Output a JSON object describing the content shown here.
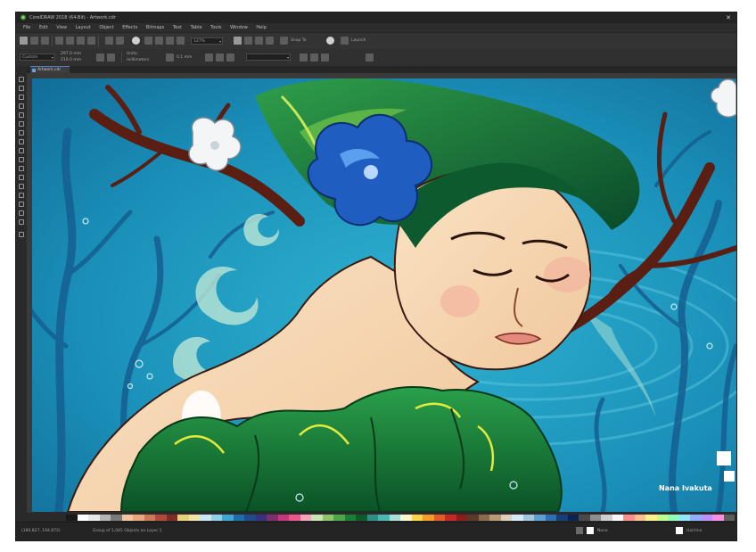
{
  "window": {
    "title": "CorelDRAW 2018 (64-Bit) - Artwork.cdr",
    "close_glyph": "✕"
  },
  "menu": [
    "File",
    "Edit",
    "View",
    "Layout",
    "Object",
    "Effects",
    "Bitmaps",
    "Text",
    "Table",
    "Tools",
    "Window",
    "Help"
  ],
  "toolbar": {
    "zoom_value": "127%",
    "snap_label": "Snap To",
    "launch_label": "Launch"
  },
  "property_bar": {
    "page_size": "Custom",
    "width": "297.0 mm",
    "height": "210.0 mm",
    "units_label": "Units:",
    "units_value": "millimeters",
    "nudge_value": "0.1 mm"
  },
  "document_tab": {
    "label": "Artwork.cdr"
  },
  "canvas": {
    "signature_text": "Nana Ivakuta"
  },
  "status": {
    "cursor": "(180.827, 194.872)",
    "selection": "Group of 1,045 Objects on Layer 1",
    "fill_label": "None",
    "outline_label": "Hairline"
  },
  "palette": {
    "colors": [
      "#1a1a1a",
      "#ffffff",
      "#e8e8e8",
      "#b5b5b5",
      "#7a7a7a",
      "#f3c4a0",
      "#e8a87c",
      "#cc7a55",
      "#b04a3a",
      "#7b2d26",
      "#e6d07a",
      "#f2e4a4",
      "#c9e7f2",
      "#8fd0e8",
      "#3fa6d1",
      "#1a6fa8",
      "#204a8a",
      "#3a2f7a",
      "#7d2e6d",
      "#c2387a",
      "#e8588a",
      "#f2a6b8",
      "#c8e6b4",
      "#8cc56e",
      "#4ea64a",
      "#1f7d3a",
      "#0f5a2a",
      "#2f8f86",
      "#4bb9b0",
      "#a8ddd6",
      "#fff6cf",
      "#ffd54a",
      "#f39c2b",
      "#e45b2a",
      "#c62828",
      "#8e1c1c",
      "#5a3a2a",
      "#8a6b4a",
      "#b89b74",
      "#ded0b8",
      "#d6eaf5",
      "#9fc8e0",
      "#5f9fd0",
      "#2d6fb0",
      "#163f78",
      "#0c2350",
      "#4a4a4a",
      "#8f8f8f",
      "#cfcfcf",
      "#f7f7f7",
      "#ff8f8f",
      "#ffbf8f",
      "#fff08f",
      "#bfff8f",
      "#8fffb8",
      "#8fe8ff",
      "#8fb0ff",
      "#c08fff",
      "#ff8fe0",
      "#5c5c5c"
    ]
  },
  "icons": {
    "app_icon": "coreldraw-balloon-icon",
    "fill_icon": "fill-icon",
    "outline_icon": "pen-icon"
  }
}
